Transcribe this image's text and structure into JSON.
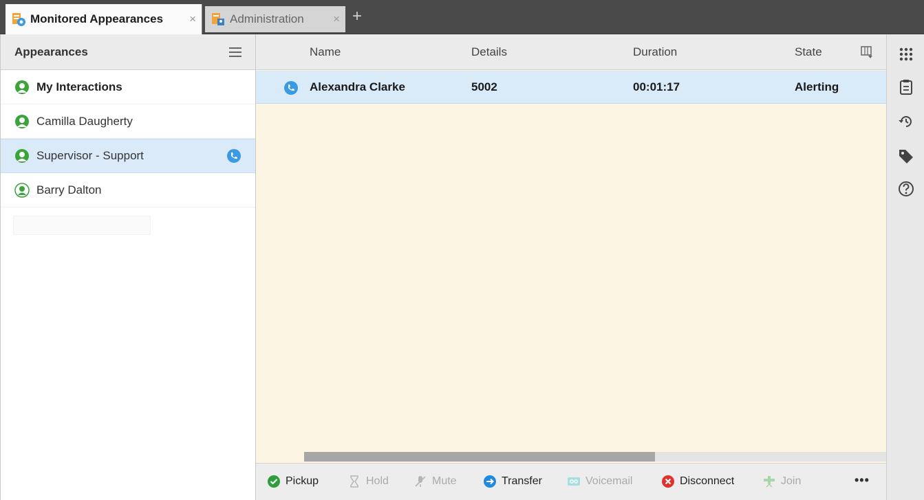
{
  "tabs": [
    {
      "label": "Monitored Appearances",
      "icon": "monitored-appearances-icon",
      "active": true
    },
    {
      "label": "Administration",
      "icon": "administration-icon",
      "active": false
    }
  ],
  "tab_add_label": "+",
  "tab_close_glyph": "×",
  "appearances": {
    "title": "Appearances",
    "items": [
      {
        "label": "My Interactions",
        "icon": "user-status-available-icon",
        "bold": true
      },
      {
        "label": "Camilla Daugherty",
        "icon": "user-status-available-icon"
      },
      {
        "label": "Supervisor - Support",
        "icon": "user-status-available-icon",
        "selected": true,
        "indicator": "phone-call-icon"
      },
      {
        "label": "Barry Dalton",
        "icon": "user-status-light-icon"
      }
    ]
  },
  "grid": {
    "columns": [
      "Name",
      "Details",
      "Duration",
      "State"
    ],
    "rows": [
      {
        "icon": "phone-call-icon",
        "name": "Alexandra Clarke",
        "details": "5002",
        "duration": "00:01:17",
        "state": "Alerting"
      }
    ]
  },
  "toolbar": {
    "buttons": [
      {
        "label": "Pickup",
        "icon": "check-circle-icon",
        "enabled": true
      },
      {
        "label": "Hold",
        "icon": "hourglass-icon",
        "enabled": false
      },
      {
        "label": "Mute",
        "icon": "mute-mic-icon",
        "enabled": false
      },
      {
        "label": "Transfer",
        "icon": "transfer-arrow-icon",
        "enabled": true
      },
      {
        "label": "Voicemail",
        "icon": "voicemail-icon",
        "enabled": false
      },
      {
        "label": "Disconnect",
        "icon": "disconnect-x-icon",
        "enabled": true
      },
      {
        "label": "Join",
        "icon": "join-icon",
        "enabled": false
      }
    ],
    "more_label": "•••"
  },
  "rail_icons": [
    "dialpad-icon",
    "clipboard-icon",
    "history-icon",
    "tag-icon",
    "help-icon"
  ],
  "colors": {
    "accent_blue": "#3b9ae1",
    "status_green": "#3aa33a",
    "selection": "#dbeaf8",
    "grid_bg": "#fdf5e3",
    "tabstrip": "#4a4a4a"
  }
}
